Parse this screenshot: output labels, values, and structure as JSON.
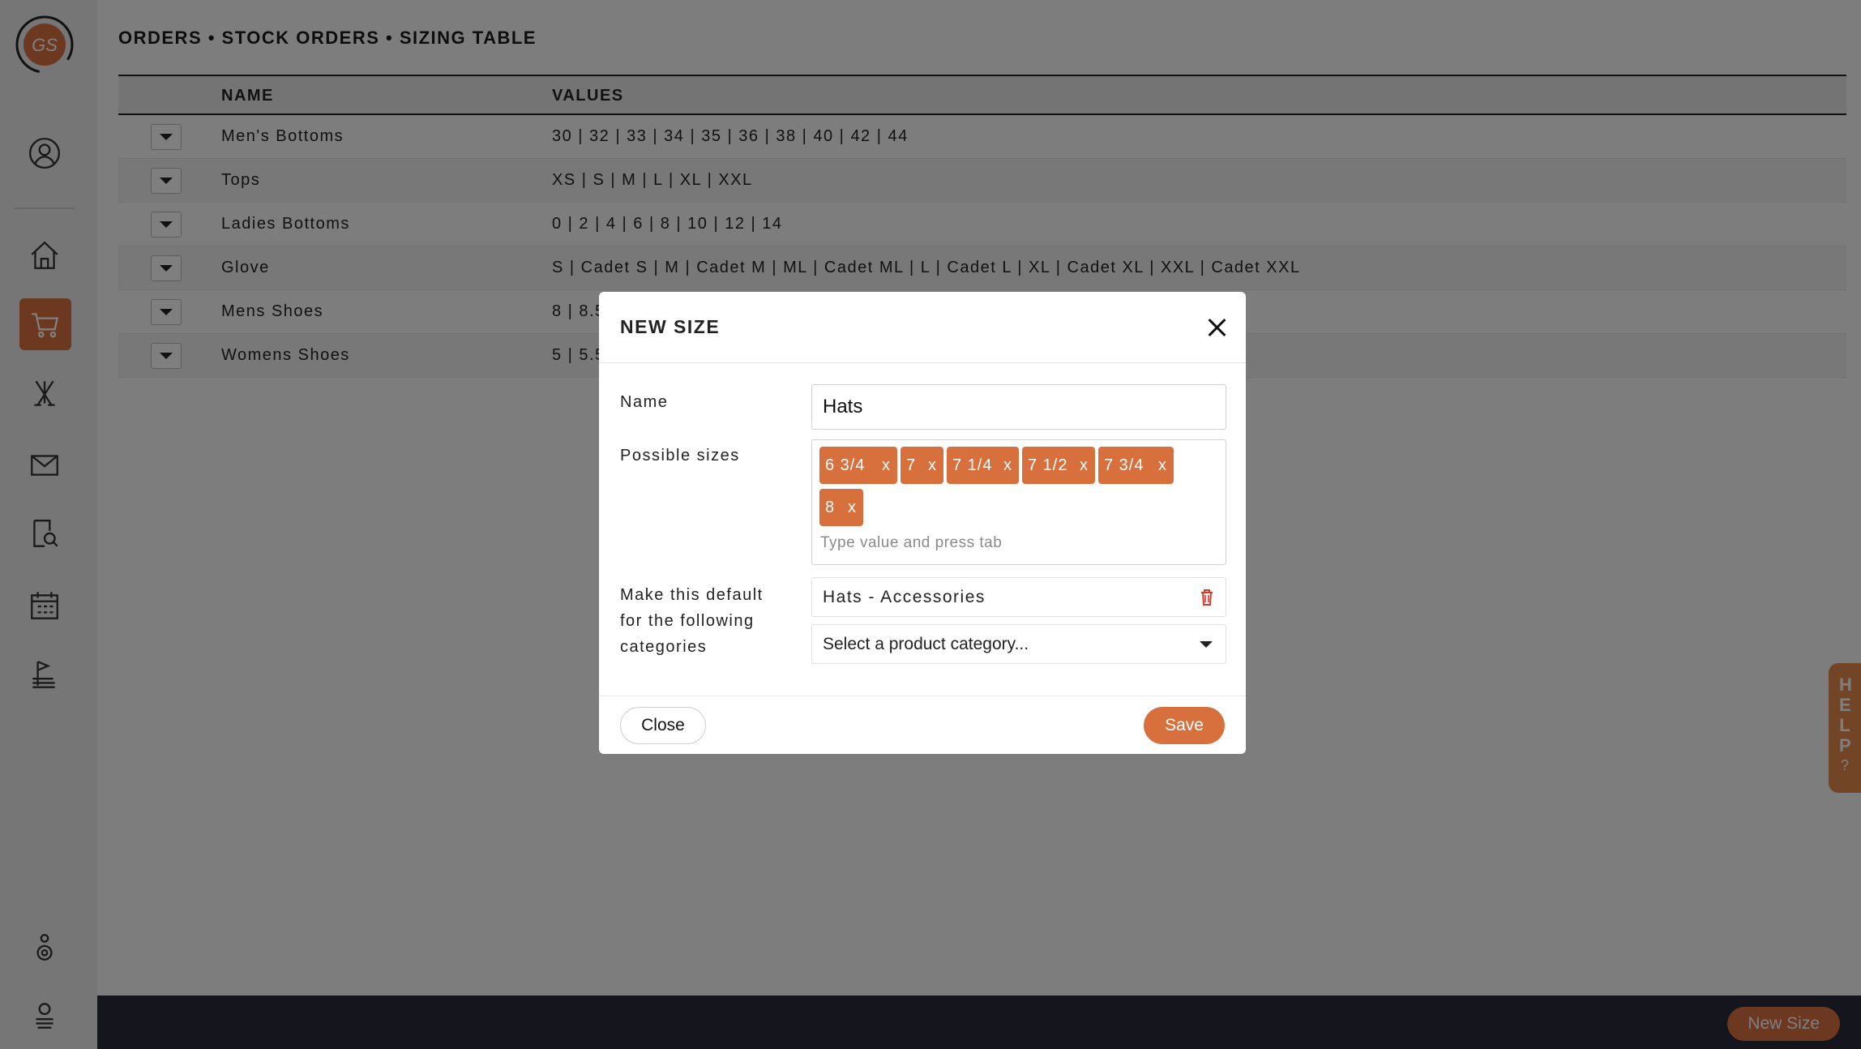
{
  "app": {
    "logo_text": "GS",
    "breadcrumb": "ORDERS • STOCK ORDERS • SIZING TABLE",
    "accent_color": "#d8703e"
  },
  "sidebar": {
    "items": [
      {
        "icon": "user-circle-icon"
      },
      {
        "icon": "home-icon"
      },
      {
        "icon": "cart-icon",
        "active": true
      },
      {
        "icon": "golf-clubs-icon"
      },
      {
        "icon": "mail-icon"
      },
      {
        "icon": "document-search-icon"
      },
      {
        "icon": "calendar-icon"
      },
      {
        "icon": "flag-icon"
      },
      {
        "icon": "settings-person-icon"
      },
      {
        "icon": "support-icon"
      }
    ]
  },
  "table": {
    "headers": {
      "name": "NAME",
      "values": "VALUES"
    },
    "rows": [
      {
        "name": "Men's Bottoms",
        "values": "30 | 32 | 33 | 34 | 35 | 36 | 38 | 40 | 42 | 44"
      },
      {
        "name": "Tops",
        "values": "XS | S | M | L | XL | XXL"
      },
      {
        "name": "Ladies Bottoms",
        "values": "0 | 2 | 4 | 6 | 8 | 10 | 12 | 14"
      },
      {
        "name": "Glove",
        "values": "S | Cadet S | M | Cadet M | ML | Cadet ML | L | Cadet L | XL | Cadet XL | XXL | Cadet XXL"
      },
      {
        "name": "Mens Shoes",
        "values": "8 | 8.5"
      },
      {
        "name": "Womens Shoes",
        "values": "5 | 5.5"
      }
    ]
  },
  "footer": {
    "new_size_label": "New Size"
  },
  "help": {
    "label": "HELP"
  },
  "modal": {
    "title": "NEW SIZE",
    "name_label": "Name",
    "name_value": "Hats",
    "sizes_label": "Possible sizes",
    "sizes": [
      "6 3/4",
      "7",
      "7 1/4",
      "7 1/2",
      "7 3/4",
      "8"
    ],
    "tag_remove": "x",
    "sizes_placeholder": "Type value and press tab",
    "default_label_lines": [
      "Make this default",
      "for the following",
      "categories"
    ],
    "selected_category": "Hats - Accessories",
    "category_placeholder": "Select a product category...",
    "close_label": "Close",
    "save_label": "Save"
  }
}
